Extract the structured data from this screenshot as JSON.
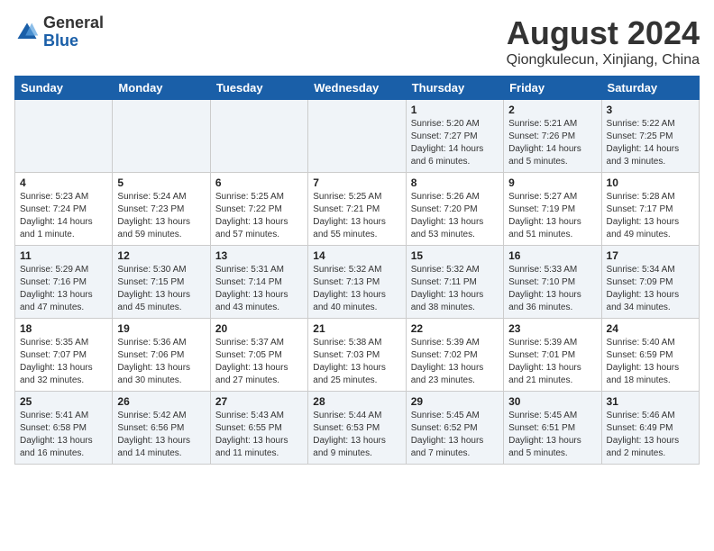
{
  "header": {
    "logo_general": "General",
    "logo_blue": "Blue",
    "month": "August 2024",
    "location": "Qiongkulecun, Xinjiang, China"
  },
  "weekdays": [
    "Sunday",
    "Monday",
    "Tuesday",
    "Wednesday",
    "Thursday",
    "Friday",
    "Saturday"
  ],
  "weeks": [
    [
      {
        "day": "",
        "info": ""
      },
      {
        "day": "",
        "info": ""
      },
      {
        "day": "",
        "info": ""
      },
      {
        "day": "",
        "info": ""
      },
      {
        "day": "1",
        "info": "Sunrise: 5:20 AM\nSunset: 7:27 PM\nDaylight: 14 hours\nand 6 minutes."
      },
      {
        "day": "2",
        "info": "Sunrise: 5:21 AM\nSunset: 7:26 PM\nDaylight: 14 hours\nand 5 minutes."
      },
      {
        "day": "3",
        "info": "Sunrise: 5:22 AM\nSunset: 7:25 PM\nDaylight: 14 hours\nand 3 minutes."
      }
    ],
    [
      {
        "day": "4",
        "info": "Sunrise: 5:23 AM\nSunset: 7:24 PM\nDaylight: 14 hours\nand 1 minute."
      },
      {
        "day": "5",
        "info": "Sunrise: 5:24 AM\nSunset: 7:23 PM\nDaylight: 13 hours\nand 59 minutes."
      },
      {
        "day": "6",
        "info": "Sunrise: 5:25 AM\nSunset: 7:22 PM\nDaylight: 13 hours\nand 57 minutes."
      },
      {
        "day": "7",
        "info": "Sunrise: 5:25 AM\nSunset: 7:21 PM\nDaylight: 13 hours\nand 55 minutes."
      },
      {
        "day": "8",
        "info": "Sunrise: 5:26 AM\nSunset: 7:20 PM\nDaylight: 13 hours\nand 53 minutes."
      },
      {
        "day": "9",
        "info": "Sunrise: 5:27 AM\nSunset: 7:19 PM\nDaylight: 13 hours\nand 51 minutes."
      },
      {
        "day": "10",
        "info": "Sunrise: 5:28 AM\nSunset: 7:17 PM\nDaylight: 13 hours\nand 49 minutes."
      }
    ],
    [
      {
        "day": "11",
        "info": "Sunrise: 5:29 AM\nSunset: 7:16 PM\nDaylight: 13 hours\nand 47 minutes."
      },
      {
        "day": "12",
        "info": "Sunrise: 5:30 AM\nSunset: 7:15 PM\nDaylight: 13 hours\nand 45 minutes."
      },
      {
        "day": "13",
        "info": "Sunrise: 5:31 AM\nSunset: 7:14 PM\nDaylight: 13 hours\nand 43 minutes."
      },
      {
        "day": "14",
        "info": "Sunrise: 5:32 AM\nSunset: 7:13 PM\nDaylight: 13 hours\nand 40 minutes."
      },
      {
        "day": "15",
        "info": "Sunrise: 5:32 AM\nSunset: 7:11 PM\nDaylight: 13 hours\nand 38 minutes."
      },
      {
        "day": "16",
        "info": "Sunrise: 5:33 AM\nSunset: 7:10 PM\nDaylight: 13 hours\nand 36 minutes."
      },
      {
        "day": "17",
        "info": "Sunrise: 5:34 AM\nSunset: 7:09 PM\nDaylight: 13 hours\nand 34 minutes."
      }
    ],
    [
      {
        "day": "18",
        "info": "Sunrise: 5:35 AM\nSunset: 7:07 PM\nDaylight: 13 hours\nand 32 minutes."
      },
      {
        "day": "19",
        "info": "Sunrise: 5:36 AM\nSunset: 7:06 PM\nDaylight: 13 hours\nand 30 minutes."
      },
      {
        "day": "20",
        "info": "Sunrise: 5:37 AM\nSunset: 7:05 PM\nDaylight: 13 hours\nand 27 minutes."
      },
      {
        "day": "21",
        "info": "Sunrise: 5:38 AM\nSunset: 7:03 PM\nDaylight: 13 hours\nand 25 minutes."
      },
      {
        "day": "22",
        "info": "Sunrise: 5:39 AM\nSunset: 7:02 PM\nDaylight: 13 hours\nand 23 minutes."
      },
      {
        "day": "23",
        "info": "Sunrise: 5:39 AM\nSunset: 7:01 PM\nDaylight: 13 hours\nand 21 minutes."
      },
      {
        "day": "24",
        "info": "Sunrise: 5:40 AM\nSunset: 6:59 PM\nDaylight: 13 hours\nand 18 minutes."
      }
    ],
    [
      {
        "day": "25",
        "info": "Sunrise: 5:41 AM\nSunset: 6:58 PM\nDaylight: 13 hours\nand 16 minutes."
      },
      {
        "day": "26",
        "info": "Sunrise: 5:42 AM\nSunset: 6:56 PM\nDaylight: 13 hours\nand 14 minutes."
      },
      {
        "day": "27",
        "info": "Sunrise: 5:43 AM\nSunset: 6:55 PM\nDaylight: 13 hours\nand 11 minutes."
      },
      {
        "day": "28",
        "info": "Sunrise: 5:44 AM\nSunset: 6:53 PM\nDaylight: 13 hours\nand 9 minutes."
      },
      {
        "day": "29",
        "info": "Sunrise: 5:45 AM\nSunset: 6:52 PM\nDaylight: 13 hours\nand 7 minutes."
      },
      {
        "day": "30",
        "info": "Sunrise: 5:45 AM\nSunset: 6:51 PM\nDaylight: 13 hours\nand 5 minutes."
      },
      {
        "day": "31",
        "info": "Sunrise: 5:46 AM\nSunset: 6:49 PM\nDaylight: 13 hours\nand 2 minutes."
      }
    ]
  ]
}
